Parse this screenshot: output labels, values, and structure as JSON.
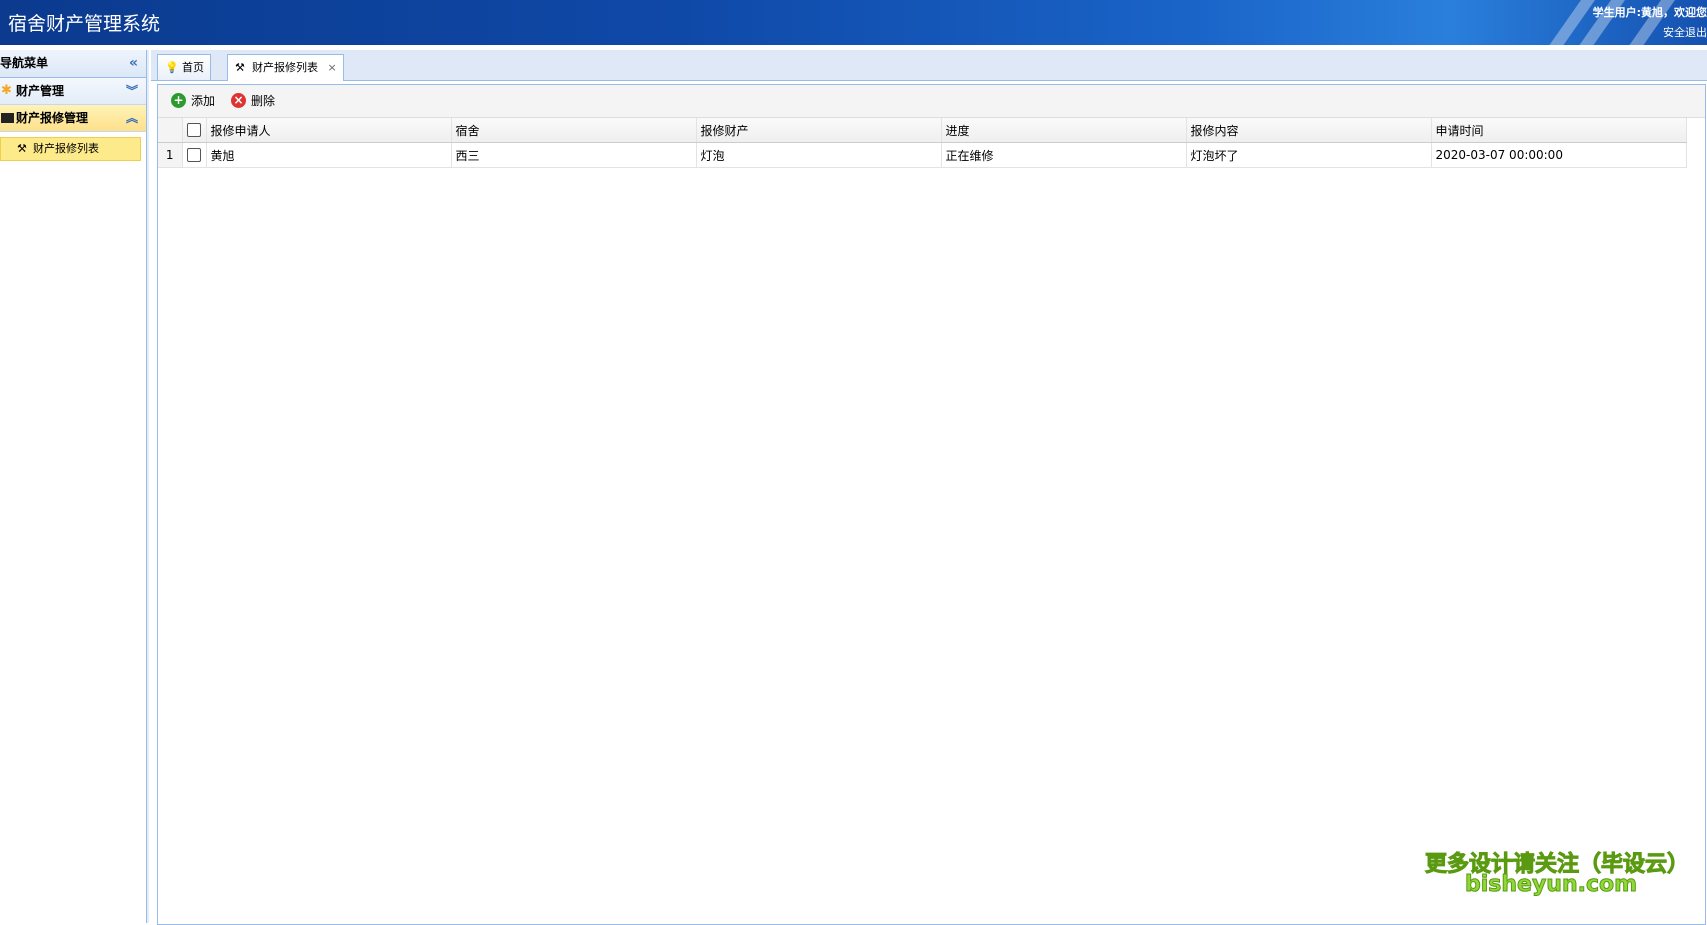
{
  "app": {
    "title": "宿舍财产管理系统",
    "user_info": "学生用户:黄旭，欢迎您",
    "logout": "安全退出"
  },
  "sidebar": {
    "header": "导航菜单",
    "groups": [
      {
        "label": "财产管理",
        "icon": "gear-icon",
        "expanded": false
      },
      {
        "label": "财产报修管理",
        "icon": "terminal-icon",
        "expanded": true,
        "items": [
          {
            "label": "财产报修列表",
            "icon": "tools-icon",
            "selected": true
          }
        ]
      }
    ]
  },
  "tabs": [
    {
      "label": "首页",
      "icon": "lightbulb-icon",
      "active": false
    },
    {
      "label": "财产报修列表",
      "icon": "tools-icon",
      "active": true,
      "close": "×"
    }
  ],
  "toolbar": {
    "add_label": "添加",
    "delete_label": "删除"
  },
  "grid": {
    "columns": [
      "报修申请人",
      "宿舍",
      "报修财产",
      "进度",
      "报修内容",
      "申请时间"
    ],
    "rows": [
      {
        "num": "1",
        "cells": [
          "黄旭",
          "西三",
          "灯泡",
          "正在维修",
          "灯泡坏了",
          "2020-03-07 00:00:00"
        ]
      }
    ]
  },
  "watermark": {
    "cn": "更多设计请关注（毕设云）",
    "en": "bisheyun.com"
  },
  "colors": {
    "header_blue": "#0f49a8",
    "selected_item": "#fdea8a",
    "border_blue": "#99bbe8"
  }
}
